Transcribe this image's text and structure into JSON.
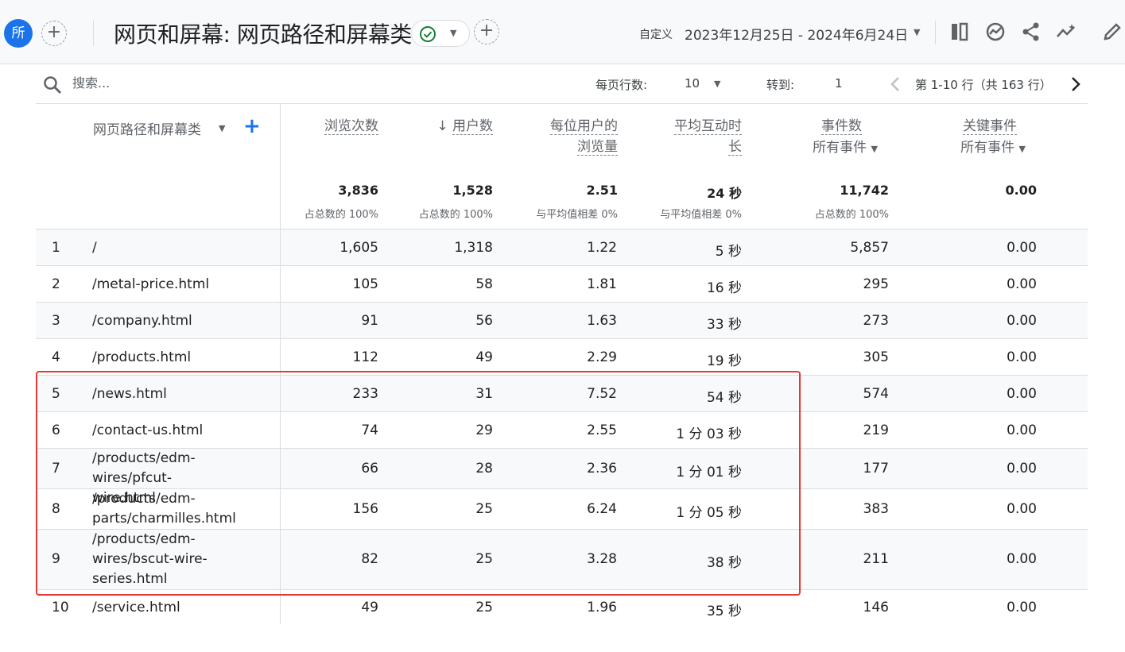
{
  "header": {
    "avatar_letter": "所",
    "title": "网页和屏幕: 网页路径和屏幕类",
    "date_range_label": "自定义",
    "date_range": "2023年12月25日 - 2024年6月24日",
    "icons": [
      "add-icon",
      "check-circle-icon",
      "chevron-down-icon",
      "compare-icon",
      "insights-icon",
      "share-icon",
      "trending-icon",
      "edit-icon"
    ],
    "accent_color": "#1a73e8",
    "status_color": "#188038"
  },
  "controls": {
    "search_placeholder": "搜索...",
    "rows_per_page_label": "每页行数:",
    "rows_per_page_value": "10",
    "goto_label": "转到:",
    "goto_value": "1",
    "pagination_text": "第 1-10 行（共 163 行）"
  },
  "table": {
    "dimension_header": "网页路径和屏幕类",
    "columns": [
      {
        "l1": "浏览次数",
        "l2": "",
        "total": "3,836",
        "total_sub": "占总数的 100%"
      },
      {
        "l1": "用户数",
        "l2": "",
        "total": "1,528",
        "total_sub": "占总数的 100%",
        "sort": "↓"
      },
      {
        "l1": "每位用户的",
        "l2": "浏览量",
        "total": "2.51",
        "total_sub": "与平均值相差 0%"
      },
      {
        "l1": "平均互动时",
        "l2": "长",
        "total": "24 秒",
        "total_sub": "与平均值相差 0%"
      },
      {
        "l1": "事件数",
        "l2": "所有事件",
        "total": "11,742",
        "total_sub": "占总数的 100%"
      },
      {
        "l1": "关键事件",
        "l2": "所有事件",
        "total": "0.00",
        "total_sub": ""
      }
    ],
    "rows": [
      {
        "idx": "1",
        "path": "/",
        "views": "1,605",
        "users": "1,318",
        "vpu": "1.22",
        "time": "5 秒",
        "events": "5,857",
        "key": "0.00"
      },
      {
        "idx": "2",
        "path": "/metal-price.html",
        "views": "105",
        "users": "58",
        "vpu": "1.81",
        "time": "16 秒",
        "events": "295",
        "key": "0.00"
      },
      {
        "idx": "3",
        "path": "/company.html",
        "views": "91",
        "users": "56",
        "vpu": "1.63",
        "time": "33 秒",
        "events": "273",
        "key": "0.00"
      },
      {
        "idx": "4",
        "path": "/products.html",
        "views": "112",
        "users": "49",
        "vpu": "2.29",
        "time": "19 秒",
        "events": "305",
        "key": "0.00"
      },
      {
        "idx": "5",
        "path": "/news.html",
        "views": "233",
        "users": "31",
        "vpu": "7.52",
        "time": "54 秒",
        "events": "574",
        "key": "0.00"
      },
      {
        "idx": "6",
        "path": "/contact-us.html",
        "views": "74",
        "users": "29",
        "vpu": "2.55",
        "time": "1 分 03 秒",
        "events": "219",
        "key": "0.00"
      },
      {
        "idx": "7",
        "path": "/products/edm-wires/pfcut-wire.html",
        "views": "66",
        "users": "28",
        "vpu": "2.36",
        "time": "1 分 01 秒",
        "events": "177",
        "key": "0.00"
      },
      {
        "idx": "8",
        "path": "/products/edm-parts/charmilles.html",
        "views": "156",
        "users": "25",
        "vpu": "6.24",
        "time": "1 分 05 秒",
        "events": "383",
        "key": "0.00"
      },
      {
        "idx": "9",
        "path": "/products/edm-wires/bscut-wire-series.html",
        "views": "82",
        "users": "25",
        "vpu": "3.28",
        "time": "38 秒",
        "events": "211",
        "key": "0.00"
      },
      {
        "idx": "10",
        "path": "/service.html",
        "views": "49",
        "users": "25",
        "vpu": "1.96",
        "time": "35 秒",
        "events": "146",
        "key": "0.00"
      }
    ]
  }
}
